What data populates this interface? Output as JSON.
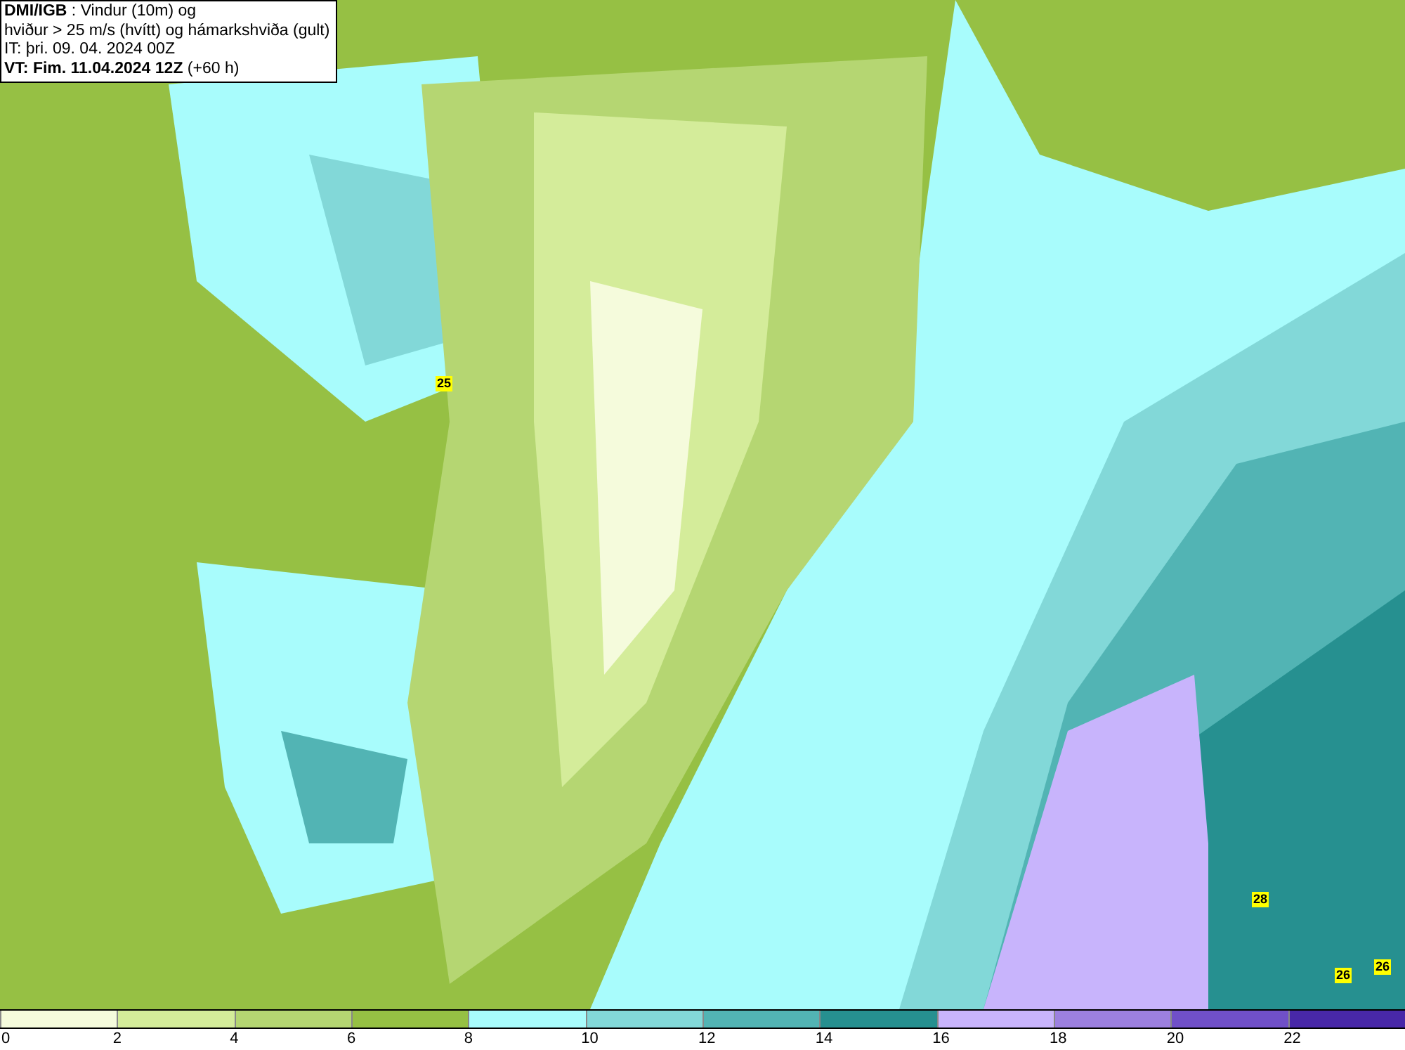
{
  "title_box": {
    "lines": [
      "**DMI/IGB** : Vindur (10m) og",
      "hviður > 25 m/s (hvítt) og hámarkshviða (gult)",
      "IT: þri. 09. 04. 2024 00Z",
      "**VT: Fim. 11.04.2024 12Z** (+60 h)"
    ]
  },
  "gust_labels": [
    "25",
    "28",
    "26",
    "26"
  ],
  "legend": [
    {
      "label": "0",
      "color": "#f5fbdc"
    },
    {
      "label": "2",
      "color": "#d4ec9a"
    },
    {
      "label": "4",
      "color": "#b5d672"
    },
    {
      "label": "6",
      "color": "#96c044"
    },
    {
      "label": "8",
      "color": "#a8fcfc"
    },
    {
      "label": "10",
      "color": "#82d8d8"
    },
    {
      "label": "12",
      "color": "#52b4b4"
    },
    {
      "label": "14",
      "color": "#269090"
    },
    {
      "label": "16",
      "color": "#c8b4fc"
    },
    {
      "label": "18",
      "color": "#9c80e0"
    },
    {
      "label": "20",
      "color": "#7050c8"
    },
    {
      "label": "22",
      "color": "#4828a8"
    }
  ]
}
